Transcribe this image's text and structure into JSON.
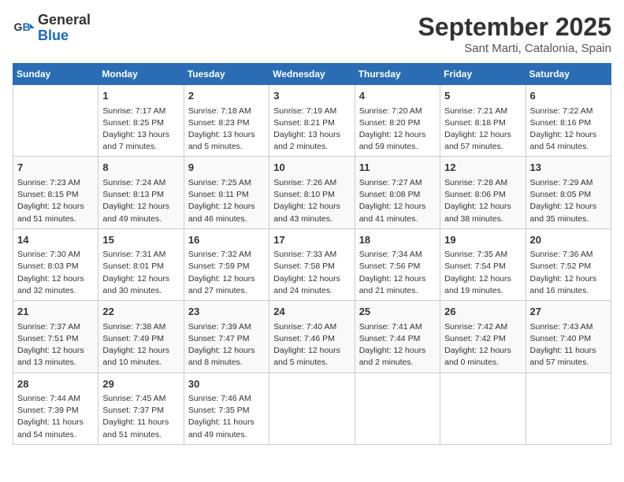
{
  "header": {
    "logo_line1": "General",
    "logo_line2": "Blue",
    "month": "September 2025",
    "location": "Sant Marti, Catalonia, Spain"
  },
  "days_of_week": [
    "Sunday",
    "Monday",
    "Tuesday",
    "Wednesday",
    "Thursday",
    "Friday",
    "Saturday"
  ],
  "weeks": [
    [
      {
        "day": "",
        "content": ""
      },
      {
        "day": "1",
        "content": "Sunrise: 7:17 AM\nSunset: 8:25 PM\nDaylight: 13 hours\nand 7 minutes."
      },
      {
        "day": "2",
        "content": "Sunrise: 7:18 AM\nSunset: 8:23 PM\nDaylight: 13 hours\nand 5 minutes."
      },
      {
        "day": "3",
        "content": "Sunrise: 7:19 AM\nSunset: 8:21 PM\nDaylight: 13 hours\nand 2 minutes."
      },
      {
        "day": "4",
        "content": "Sunrise: 7:20 AM\nSunset: 8:20 PM\nDaylight: 12 hours\nand 59 minutes."
      },
      {
        "day": "5",
        "content": "Sunrise: 7:21 AM\nSunset: 8:18 PM\nDaylight: 12 hours\nand 57 minutes."
      },
      {
        "day": "6",
        "content": "Sunrise: 7:22 AM\nSunset: 8:16 PM\nDaylight: 12 hours\nand 54 minutes."
      }
    ],
    [
      {
        "day": "7",
        "content": "Sunrise: 7:23 AM\nSunset: 8:15 PM\nDaylight: 12 hours\nand 51 minutes."
      },
      {
        "day": "8",
        "content": "Sunrise: 7:24 AM\nSunset: 8:13 PM\nDaylight: 12 hours\nand 49 minutes."
      },
      {
        "day": "9",
        "content": "Sunrise: 7:25 AM\nSunset: 8:11 PM\nDaylight: 12 hours\nand 46 minutes."
      },
      {
        "day": "10",
        "content": "Sunrise: 7:26 AM\nSunset: 8:10 PM\nDaylight: 12 hours\nand 43 minutes."
      },
      {
        "day": "11",
        "content": "Sunrise: 7:27 AM\nSunset: 8:08 PM\nDaylight: 12 hours\nand 41 minutes."
      },
      {
        "day": "12",
        "content": "Sunrise: 7:28 AM\nSunset: 8:06 PM\nDaylight: 12 hours\nand 38 minutes."
      },
      {
        "day": "13",
        "content": "Sunrise: 7:29 AM\nSunset: 8:05 PM\nDaylight: 12 hours\nand 35 minutes."
      }
    ],
    [
      {
        "day": "14",
        "content": "Sunrise: 7:30 AM\nSunset: 8:03 PM\nDaylight: 12 hours\nand 32 minutes."
      },
      {
        "day": "15",
        "content": "Sunrise: 7:31 AM\nSunset: 8:01 PM\nDaylight: 12 hours\nand 30 minutes."
      },
      {
        "day": "16",
        "content": "Sunrise: 7:32 AM\nSunset: 7:59 PM\nDaylight: 12 hours\nand 27 minutes."
      },
      {
        "day": "17",
        "content": "Sunrise: 7:33 AM\nSunset: 7:58 PM\nDaylight: 12 hours\nand 24 minutes."
      },
      {
        "day": "18",
        "content": "Sunrise: 7:34 AM\nSunset: 7:56 PM\nDaylight: 12 hours\nand 21 minutes."
      },
      {
        "day": "19",
        "content": "Sunrise: 7:35 AM\nSunset: 7:54 PM\nDaylight: 12 hours\nand 19 minutes."
      },
      {
        "day": "20",
        "content": "Sunrise: 7:36 AM\nSunset: 7:52 PM\nDaylight: 12 hours\nand 16 minutes."
      }
    ],
    [
      {
        "day": "21",
        "content": "Sunrise: 7:37 AM\nSunset: 7:51 PM\nDaylight: 12 hours\nand 13 minutes."
      },
      {
        "day": "22",
        "content": "Sunrise: 7:38 AM\nSunset: 7:49 PM\nDaylight: 12 hours\nand 10 minutes."
      },
      {
        "day": "23",
        "content": "Sunrise: 7:39 AM\nSunset: 7:47 PM\nDaylight: 12 hours\nand 8 minutes."
      },
      {
        "day": "24",
        "content": "Sunrise: 7:40 AM\nSunset: 7:46 PM\nDaylight: 12 hours\nand 5 minutes."
      },
      {
        "day": "25",
        "content": "Sunrise: 7:41 AM\nSunset: 7:44 PM\nDaylight: 12 hours\nand 2 minutes."
      },
      {
        "day": "26",
        "content": "Sunrise: 7:42 AM\nSunset: 7:42 PM\nDaylight: 12 hours\nand 0 minutes."
      },
      {
        "day": "27",
        "content": "Sunrise: 7:43 AM\nSunset: 7:40 PM\nDaylight: 11 hours\nand 57 minutes."
      }
    ],
    [
      {
        "day": "28",
        "content": "Sunrise: 7:44 AM\nSunset: 7:39 PM\nDaylight: 11 hours\nand 54 minutes."
      },
      {
        "day": "29",
        "content": "Sunrise: 7:45 AM\nSunset: 7:37 PM\nDaylight: 11 hours\nand 51 minutes."
      },
      {
        "day": "30",
        "content": "Sunrise: 7:46 AM\nSunset: 7:35 PM\nDaylight: 11 hours\nand 49 minutes."
      },
      {
        "day": "",
        "content": ""
      },
      {
        "day": "",
        "content": ""
      },
      {
        "day": "",
        "content": ""
      },
      {
        "day": "",
        "content": ""
      }
    ]
  ]
}
